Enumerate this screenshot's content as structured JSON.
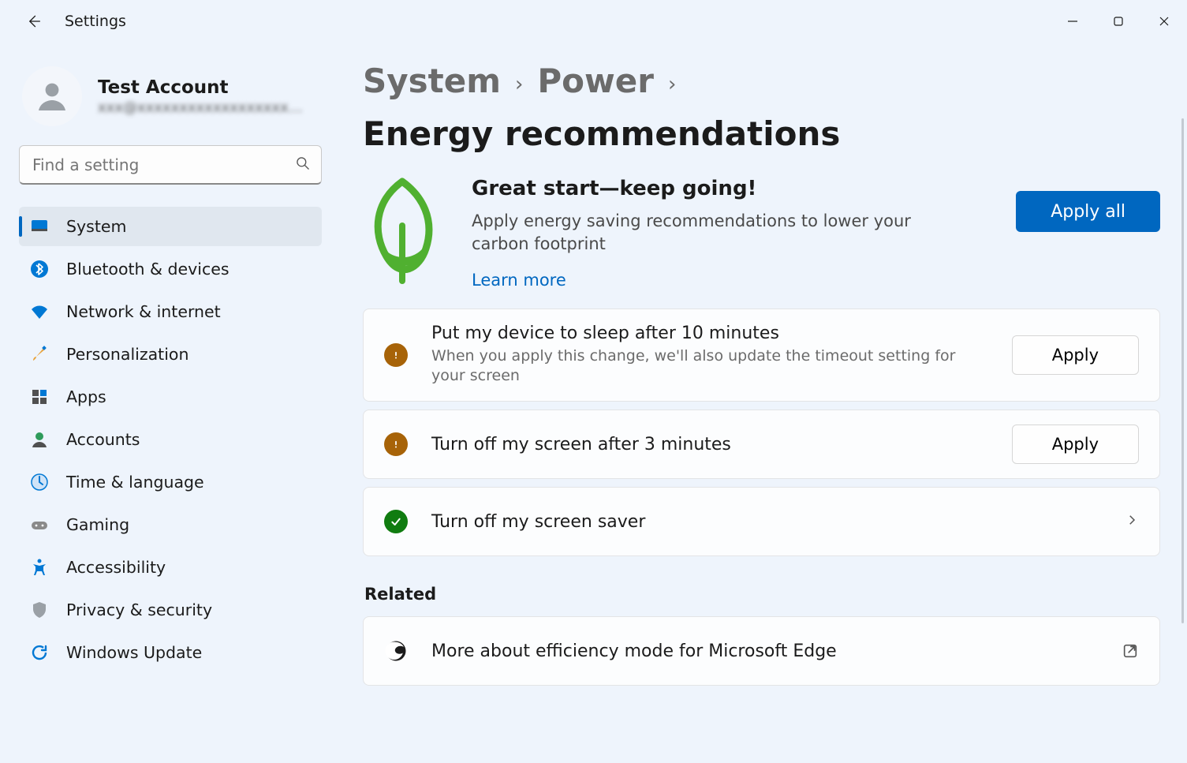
{
  "app_title": "Settings",
  "account": {
    "name": "Test Account",
    "email": "xxx@xxxxxxxxxxxxxxxxxx.xx…"
  },
  "search": {
    "placeholder": "Find a setting"
  },
  "sidebar": {
    "items": [
      {
        "label": "System",
        "selected": true
      },
      {
        "label": "Bluetooth & devices"
      },
      {
        "label": "Network & internet"
      },
      {
        "label": "Personalization"
      },
      {
        "label": "Apps"
      },
      {
        "label": "Accounts"
      },
      {
        "label": "Time & language"
      },
      {
        "label": "Gaming"
      },
      {
        "label": "Accessibility"
      },
      {
        "label": "Privacy & security"
      },
      {
        "label": "Windows Update"
      }
    ]
  },
  "breadcrumbs": {
    "c0": "System",
    "c1": "Power",
    "c2": "Energy recommendations"
  },
  "hero": {
    "title": "Great start—keep going!",
    "subtitle": "Apply energy saving recommendations to lower your carbon footprint",
    "learn_more": "Learn more",
    "apply_all": "Apply all"
  },
  "recommendations": [
    {
      "status": "warn",
      "title": "Put my device to sleep after 10 minutes",
      "subtitle": "When you apply this change, we'll also update the timeout setting for your screen",
      "action": "Apply"
    },
    {
      "status": "warn",
      "title": "Turn off my screen after 3 minutes",
      "action": "Apply"
    },
    {
      "status": "ok",
      "title": "Turn off my screen saver",
      "chevron": true
    }
  ],
  "related": {
    "header": "Related",
    "items": [
      {
        "title": "More about efficiency mode for Microsoft Edge"
      }
    ]
  },
  "colors": {
    "accent": "#0067c0",
    "warn": "#a76308",
    "ok": "#107c10"
  }
}
